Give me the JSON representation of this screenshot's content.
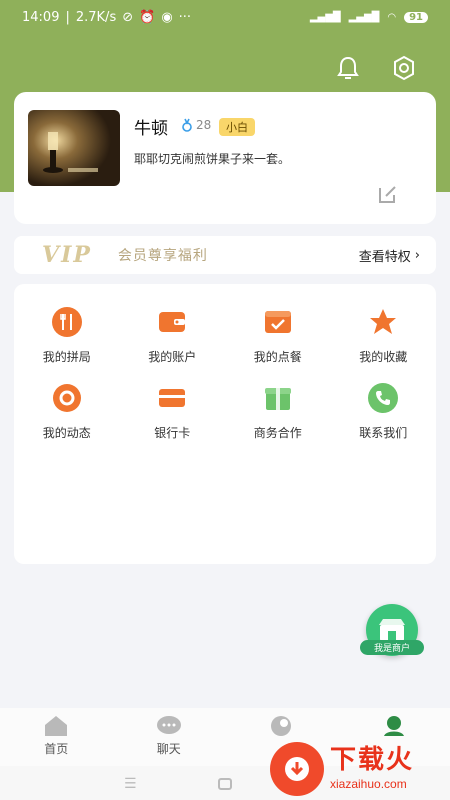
{
  "status_bar": {
    "time": "14:09",
    "speed": "2.7K/s",
    "battery": "91",
    "icons": [
      "alarm-off-icon",
      "alarm-icon",
      "wechat-icon",
      "more-dots-icon",
      "signal-icon",
      "wifi-icon",
      "battery-icon"
    ]
  },
  "header": {
    "icons": [
      "bell-icon",
      "settings-icon"
    ]
  },
  "profile": {
    "username": "牛顿",
    "level": "28",
    "badge": "小白",
    "bio": "耶耶切克闹煎饼果子来一套。"
  },
  "vip": {
    "logo": "VIP",
    "text": "会员尊享福利",
    "link": "查看特权"
  },
  "menu": {
    "items": [
      {
        "label": "我的拼局",
        "icon": "utensils-icon"
      },
      {
        "label": "我的账户",
        "icon": "wallet-icon"
      },
      {
        "label": "我的点餐",
        "icon": "order-check-icon"
      },
      {
        "label": "我的收藏",
        "icon": "star-icon"
      },
      {
        "label": "我的动态",
        "icon": "ring-icon"
      },
      {
        "label": "银行卡",
        "icon": "bank-card-icon"
      },
      {
        "label": "商务合作",
        "icon": "gift-box-icon"
      },
      {
        "label": "联系我们",
        "icon": "phone-icon"
      }
    ]
  },
  "merchant": {
    "label": "我是商户"
  },
  "tabbar": {
    "tabs": [
      {
        "label": "首页",
        "icon": "home-icon"
      },
      {
        "label": "聊天",
        "icon": "chat-icon"
      },
      {
        "label": "",
        "icon": "circle-icon"
      },
      {
        "label": "",
        "icon": "profile-icon"
      }
    ]
  },
  "watermark": {
    "title": "下载火",
    "sub": "xiazaihuo.com"
  },
  "colors": {
    "accent_green": "#8fb05a",
    "orange_icon": "#f0752f",
    "green_icon": "#6cc36a",
    "badge_yellow": "#f9d66a",
    "merchant_green": "#3bc47b"
  }
}
